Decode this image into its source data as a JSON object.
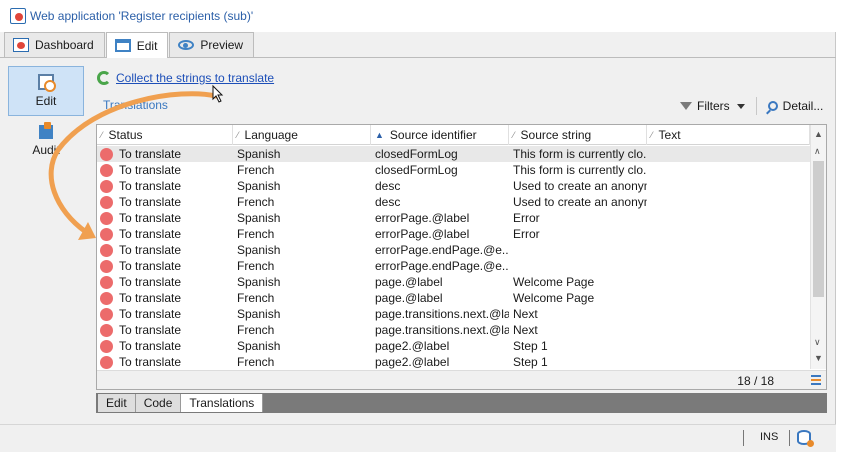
{
  "window": {
    "title": "Web application 'Register recipients (sub)'"
  },
  "tabs": [
    {
      "label": "Dashboard",
      "icon": "dashboard-icon",
      "active": false
    },
    {
      "label": "Edit",
      "icon": "edit-icon",
      "active": true
    },
    {
      "label": "Preview",
      "icon": "eye-icon",
      "active": false
    }
  ],
  "sidebar": {
    "items": [
      {
        "label": "Edit",
        "icon": "edit-search-icon",
        "active": true
      },
      {
        "label": "Audit",
        "icon": "audit-icon",
        "active": false
      }
    ]
  },
  "action": {
    "collect_label": "Collect the strings to translate",
    "icon": "refresh-icon"
  },
  "section": {
    "label": "Translations"
  },
  "toolbar": {
    "filters_label": "Filters",
    "detail_label": "Detail..."
  },
  "grid": {
    "columns": [
      "Status",
      "Language",
      "Source identifier",
      "Source string",
      "Text"
    ],
    "sorted_column": "Source identifier",
    "rows": [
      {
        "status": "To translate",
        "language": "Spanish",
        "source_id": "closedFormLog",
        "source_string": "This form is currently clo...",
        "text": ""
      },
      {
        "status": "To translate",
        "language": "French",
        "source_id": "closedFormLog",
        "source_string": "This form is currently clo...",
        "text": ""
      },
      {
        "status": "To translate",
        "language": "Spanish",
        "source_id": "desc",
        "source_string": "Used to create an anonym",
        "text": ""
      },
      {
        "status": "To translate",
        "language": "French",
        "source_id": "desc",
        "source_string": "Used to create an anonym",
        "text": ""
      },
      {
        "status": "To translate",
        "language": "Spanish",
        "source_id": "errorPage.@label",
        "source_string": "Error",
        "text": ""
      },
      {
        "status": "To translate",
        "language": "French",
        "source_id": "errorPage.@label",
        "source_string": "Error",
        "text": ""
      },
      {
        "status": "To translate",
        "language": "Spanish",
        "source_id": "errorPage.endPage.@e...",
        "source_string": "",
        "text": ""
      },
      {
        "status": "To translate",
        "language": "French",
        "source_id": "errorPage.endPage.@e...",
        "source_string": "",
        "text": ""
      },
      {
        "status": "To translate",
        "language": "Spanish",
        "source_id": "page.@label",
        "source_string": "Welcome Page",
        "text": ""
      },
      {
        "status": "To translate",
        "language": "French",
        "source_id": "page.@label",
        "source_string": "Welcome Page",
        "text": ""
      },
      {
        "status": "To translate",
        "language": "Spanish",
        "source_id": "page.transitions.next.@la...",
        "source_string": "Next",
        "text": ""
      },
      {
        "status": "To translate",
        "language": "French",
        "source_id": "page.transitions.next.@la...",
        "source_string": "Next",
        "text": ""
      },
      {
        "status": "To translate",
        "language": "Spanish",
        "source_id": "page2.@label",
        "source_string": "Step 1",
        "text": ""
      },
      {
        "status": "To translate",
        "language": "French",
        "source_id": "page2.@label",
        "source_string": "Step 1",
        "text": ""
      }
    ],
    "count": "18 / 18"
  },
  "bottom_tabs": [
    {
      "label": "Edit",
      "active": false
    },
    {
      "label": "Code",
      "active": false
    },
    {
      "label": "Translations",
      "active": true
    }
  ],
  "statusbar": {
    "mode": "INS"
  },
  "colors": {
    "status_dot": "#ec6b6b",
    "link": "#1d4fb8",
    "accent_blue": "#3a78c0",
    "arrow_orange": "#f0a050",
    "active_sidebar": "#cfe3f7"
  }
}
